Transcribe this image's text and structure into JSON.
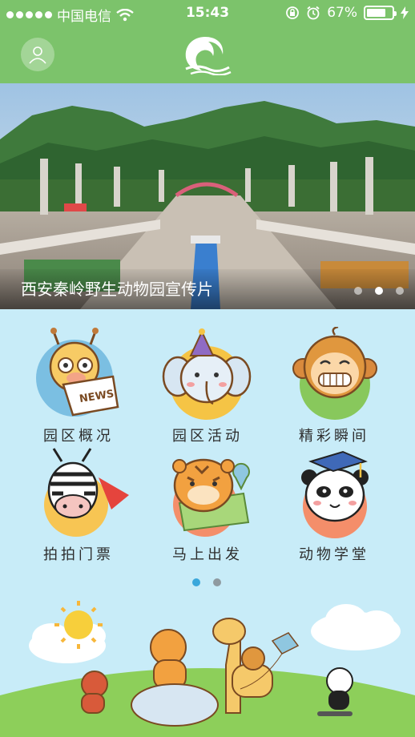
{
  "status": {
    "carrier": "中国电信",
    "time": "15:43",
    "battery": "67%",
    "battery_level": 0.67
  },
  "header": {
    "avatar_icon": "user-icon",
    "logo_icon": "wave-logo-icon"
  },
  "banner": {
    "title": "西安秦岭野生动物园宣传片",
    "active_slide": 2,
    "slide_count": 3
  },
  "menu": {
    "items": [
      {
        "label": "园区概况",
        "icon": "giraffe-news-icon"
      },
      {
        "label": "园区活动",
        "icon": "elephant-party-icon"
      },
      {
        "label": "精彩瞬间",
        "icon": "monkey-icon"
      },
      {
        "label": "拍拍门票",
        "icon": "zebra-icon"
      },
      {
        "label": "马上出发",
        "icon": "tiger-map-icon"
      },
      {
        "label": "动物学堂",
        "icon": "panda-graduate-icon"
      }
    ],
    "active_page": 1,
    "page_count": 2
  },
  "colors": {
    "header_green": "#7cc36b",
    "background": "#c8ecf8",
    "active_dot": "#3aa7db"
  }
}
